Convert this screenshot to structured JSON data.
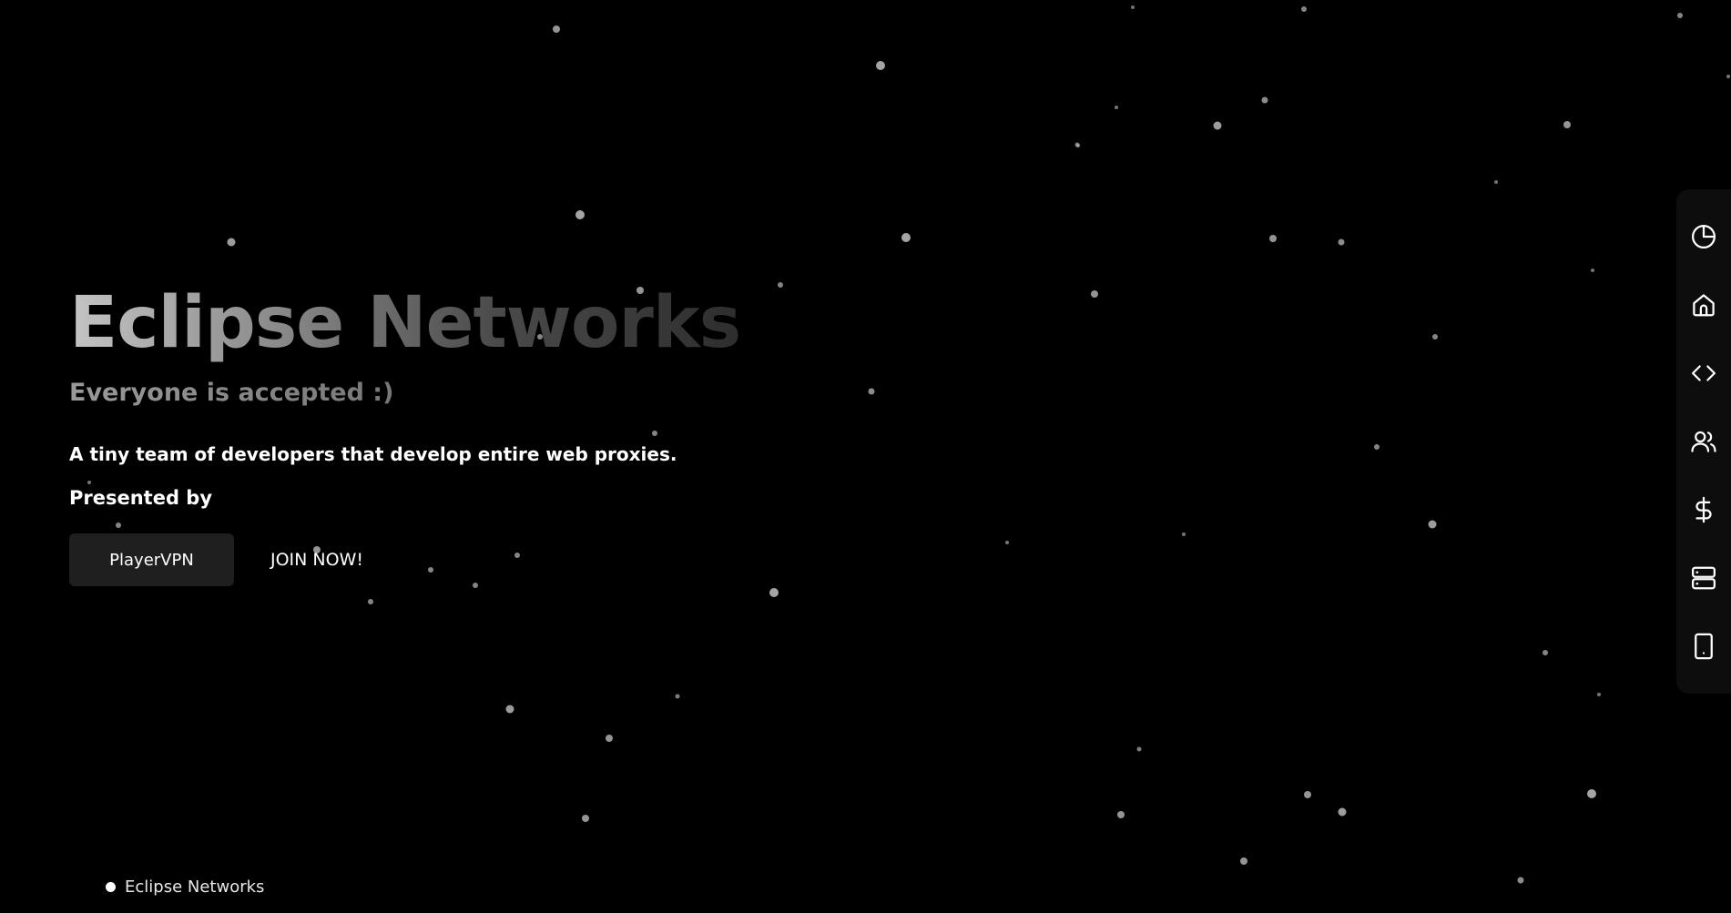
{
  "hero": {
    "title": "Eclipse Networks",
    "subtitle": "Everyone is accepted :)",
    "description": "A tiny team of developers that develop entire web proxies.",
    "presented_by": "Presented by"
  },
  "actions": {
    "primary_label": "PlayerVPN",
    "secondary_label": "JOIN NOW!"
  },
  "sidebar": {
    "items": [
      {
        "name": "pie-chart-icon"
      },
      {
        "name": "home-icon"
      },
      {
        "name": "code-icon"
      },
      {
        "name": "users-icon"
      },
      {
        "name": "dollar-icon"
      },
      {
        "name": "server-icon"
      },
      {
        "name": "tablet-icon"
      }
    ]
  },
  "footer": {
    "brand": "Eclipse Networks"
  },
  "colors": {
    "background": "#000000",
    "primary_button": "#1f1f1f",
    "sidebar": "#0d0d0d",
    "star": "#bdbdbd"
  }
}
